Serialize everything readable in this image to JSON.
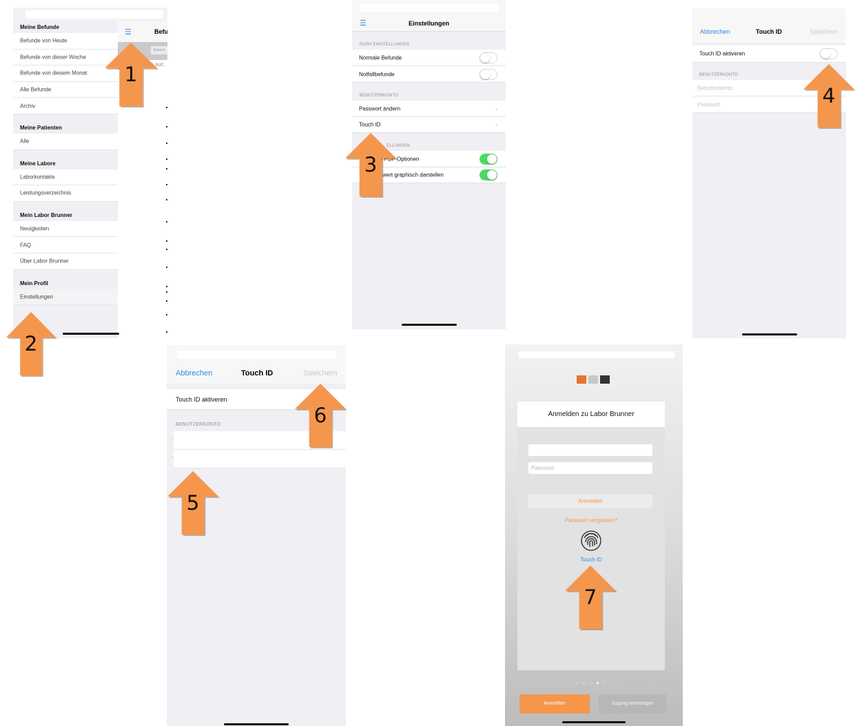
{
  "colors": {
    "accent_orange": "#f5964d",
    "ios_blue": "#2e8ae6",
    "toggle_green": "#4cd964",
    "disabled_gray": "#c8c8cc"
  },
  "screen1": {
    "menu_sections": [
      {
        "title": "Meine Befunde",
        "items": [
          "Befunde von Heute",
          "Befunde von dieser Woche",
          "Befunde von diesem Monat",
          "Alle Befunde",
          "Archiv"
        ]
      },
      {
        "title": "Meine Patienten",
        "items": [
          "Alle"
        ]
      },
      {
        "title": "Meine Labore",
        "items": [
          "Laborkontakte",
          "Leistungsverzeichnis"
        ]
      },
      {
        "title": "Mein Labor Brunner",
        "items": [
          "Neuigkeiten",
          "FAQ",
          "Über Labor Brunner"
        ]
      },
      {
        "title": "Mein Profil",
        "items": [
          "Einstellungen"
        ]
      }
    ],
    "nav_title": "Befu",
    "search_hint": "Befund",
    "search_placeholder": "unde suc",
    "menu_icon": "hamburger-icon"
  },
  "screen2": {
    "title": "Einstellungen",
    "push_header": "PUSH EINSTELLUNGEN",
    "push_rows": [
      "Normale Befunde",
      "Notfallbefunde"
    ],
    "account_header": "BENUTZERKONTO",
    "account_rows": [
      "Passwort ändern",
      "Touch ID"
    ],
    "other_header": "ELLUNGEN",
    "other_rows": [
      "e PDF Optionen",
      "wert graphisch darstellen"
    ]
  },
  "screen3": {
    "cancel": "Abbrechen",
    "title": "Touch ID",
    "save": "Speichern",
    "toggle_label": "Touch ID aktiveren",
    "account_header": "BENUTZERKONTO",
    "user_placeholder": "Benutzerkonto",
    "password_placeholder": "Passwort"
  },
  "screen4": {
    "cancel": "Abbrechen",
    "title": "Touch ID",
    "save": "Speichern",
    "toggle_label": "Touch ID aktiveren",
    "account_header": "BENUTZERKONTO"
  },
  "screen5": {
    "login_title": "Anmelden zu Labor Brunner",
    "password_placeholder": "Passwort",
    "login_button": "Anmelden",
    "forgot": "Passwort vergessen?",
    "touchid_label": "Touch ID",
    "bottom_login": "Anmelden",
    "bottom_request": "Zugang beantragen",
    "page_dots": 5,
    "active_dot": 3,
    "fingerprint_icon": "fingerprint-icon",
    "logo": "labor-logo"
  },
  "arrows": [
    "1",
    "2",
    "3",
    "4",
    "5",
    "6",
    "7"
  ]
}
